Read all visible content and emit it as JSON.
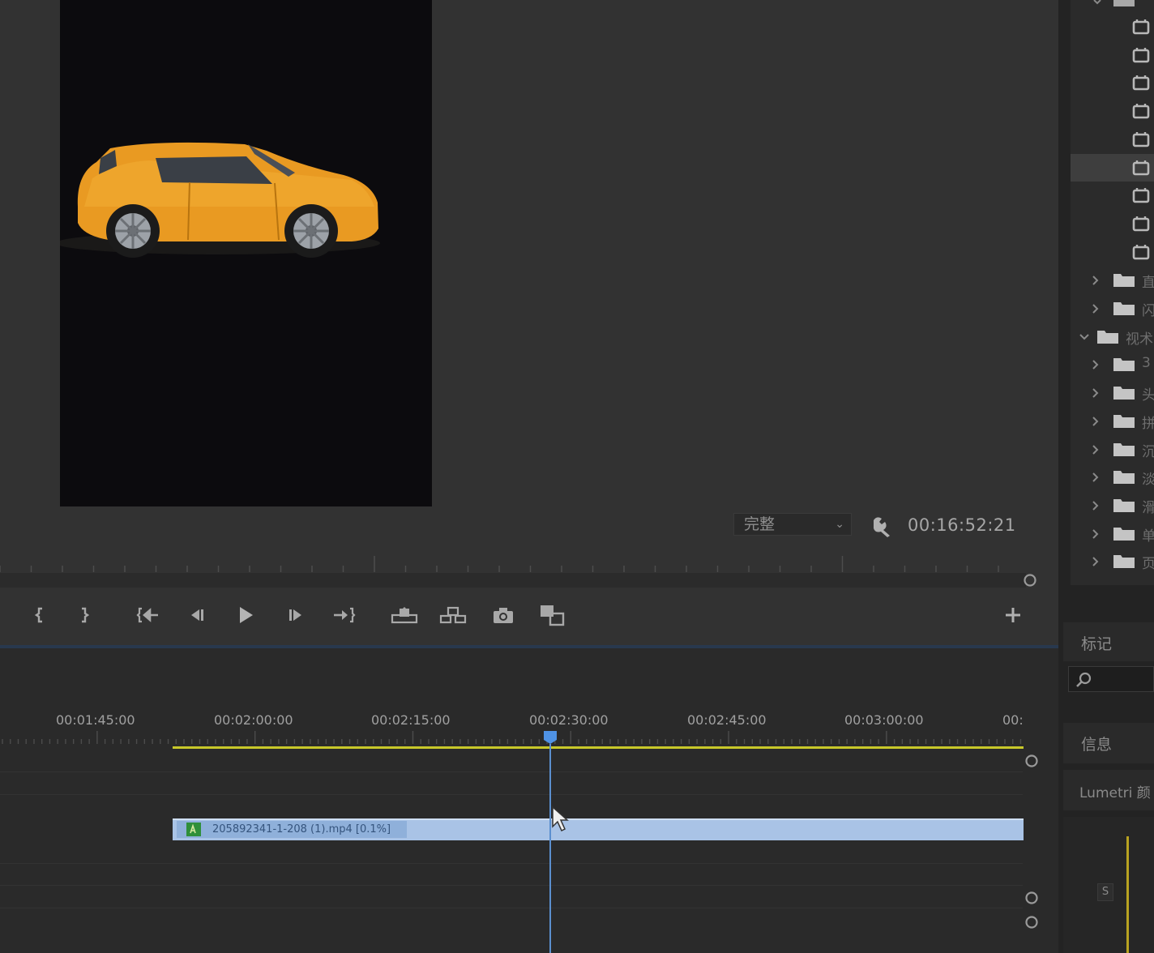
{
  "program_monitor": {
    "quality": "完整",
    "timecode": "00:16:52:21",
    "transport_buttons": [
      {
        "name": "mark-in-button",
        "icon": "mark-in-icon"
      },
      {
        "name": "mark-out-button",
        "icon": "mark-out-icon"
      },
      {
        "name": "go-to-in-button",
        "icon": "go-to-in-icon"
      },
      {
        "name": "step-back-button",
        "icon": "step-back-icon"
      },
      {
        "name": "play-button",
        "icon": "play-icon"
      },
      {
        "name": "step-forward-button",
        "icon": "step-forward-icon"
      },
      {
        "name": "go-to-out-button",
        "icon": "go-to-out-icon"
      },
      {
        "name": "lift-button",
        "icon": "lift-icon"
      },
      {
        "name": "extract-button",
        "icon": "extract-icon"
      },
      {
        "name": "export-frame-button",
        "icon": "camera-icon"
      },
      {
        "name": "comparison-view-button",
        "icon": "comparison-icon"
      },
      {
        "name": "add-button",
        "icon": "plus-icon"
      }
    ]
  },
  "timeline": {
    "ruler_labels": [
      "00:01:45:00",
      "00:02:00:00",
      "00:02:15:00",
      "00:02:30:00",
      "00:02:45:00",
      "00:03:00:00",
      "00:"
    ],
    "clip": {
      "name": "205892341-1-208 (1).mp4 [0.1%]",
      "fx": "fx"
    },
    "work_area_color": "#c8c82a",
    "playhead_color": "#5b8fcf"
  },
  "right_panel": {
    "project_items": [
      {
        "type": "clip",
        "label": ""
      },
      {
        "type": "clip",
        "label": ""
      },
      {
        "type": "clip",
        "label": ""
      },
      {
        "type": "clip",
        "label": ""
      },
      {
        "type": "clip",
        "label": ""
      },
      {
        "type": "clip",
        "label": "",
        "selected": true
      },
      {
        "type": "clip",
        "label": ""
      },
      {
        "type": "clip",
        "label": ""
      },
      {
        "type": "clip",
        "label": ""
      },
      {
        "type": "folder",
        "label": "直"
      },
      {
        "type": "folder",
        "label": "闪"
      },
      {
        "type": "folder-open",
        "label": "视术"
      },
      {
        "type": "folder",
        "label": "3"
      },
      {
        "type": "folder",
        "label": "头"
      },
      {
        "type": "folder",
        "label": "拼"
      },
      {
        "type": "folder",
        "label": "沉"
      },
      {
        "type": "folder",
        "label": "淡"
      },
      {
        "type": "folder",
        "label": "滑"
      },
      {
        "type": "folder",
        "label": "单"
      },
      {
        "type": "folder",
        "label": "页"
      }
    ],
    "markers_title": "标记",
    "info_title": "信息",
    "lumetri_title": "Lumetri 颜",
    "lumetri_scale_label": "S"
  }
}
